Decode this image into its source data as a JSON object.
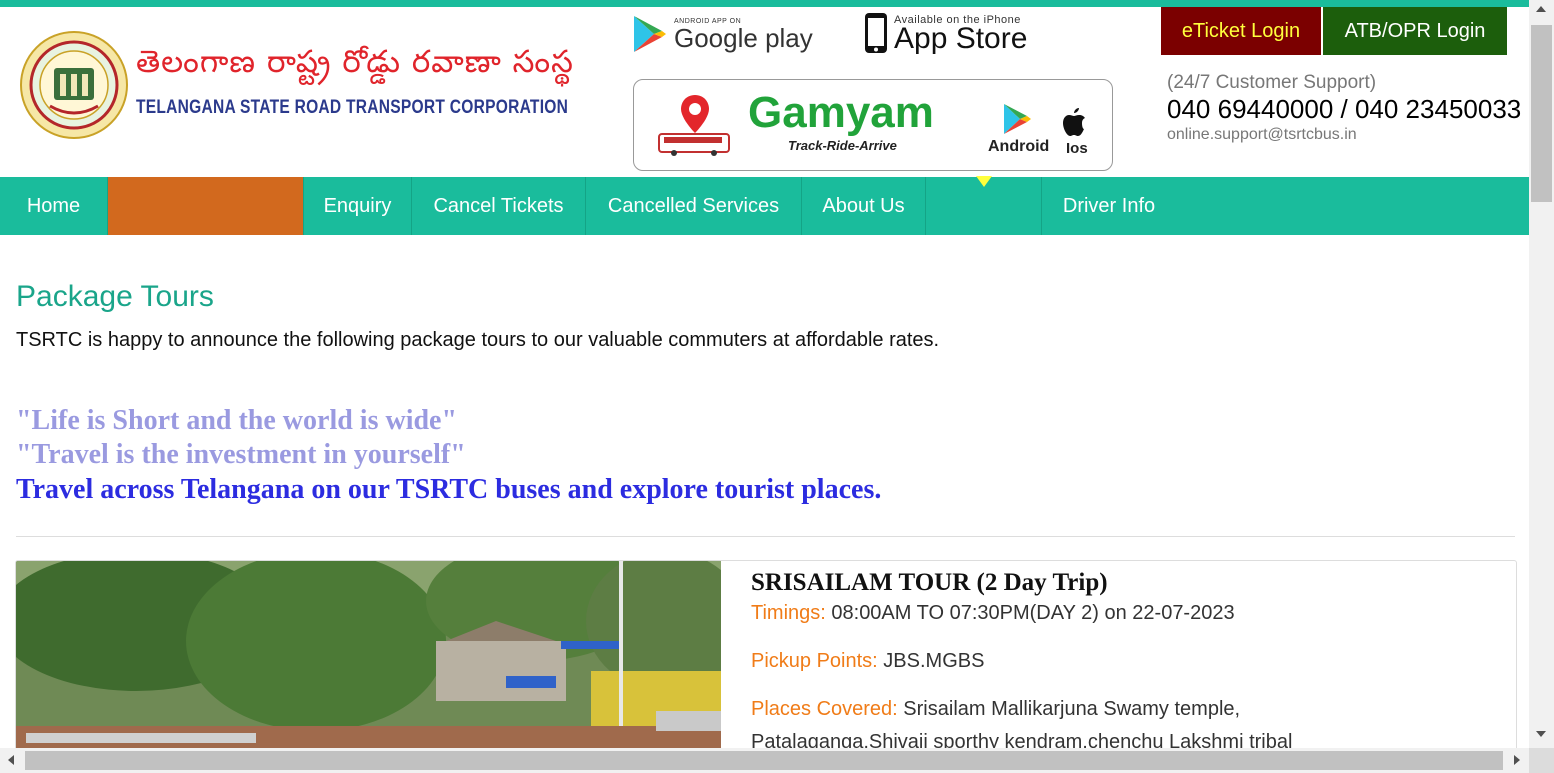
{
  "header": {
    "brand_telugu": "తెలంగాణ  రాష్ట్ర రోడ్డు రవాణా సంస్థ",
    "brand_english": "TELANGANA STATE ROAD TRANSPORT CORPORATION",
    "google_small": "ANDROID APP ON",
    "google_big": "Google play",
    "apple_small": "Available on the iPhone",
    "apple_big": "App Store",
    "gamyam": {
      "title": "Gamyam",
      "tagline": "Track-Ride-Arrive",
      "android": "Android",
      "ios": "Ios"
    },
    "eticket_label": "eTicket Login",
    "atb_label": "ATB/OPR Login",
    "support_label": "(24/7 Customer Support)",
    "support_phone": "040 69440000 / 040 23450033",
    "support_email": "online.support@tsrtcbus.in"
  },
  "nav": {
    "items": [
      {
        "label": "Home"
      },
      {
        "label": ""
      },
      {
        "label": "Enquiry"
      },
      {
        "label": "Cancel Tickets"
      },
      {
        "label": "Cancelled Services"
      },
      {
        "label": "About Us"
      },
      {
        "label": ""
      },
      {
        "label": "Driver Info"
      }
    ]
  },
  "main": {
    "title": "Package Tours",
    "intro": "TSRTC is happy to announce the following package tours to our valuable commuters at affordable rates.",
    "quote1": "\"Life is Short and the world is wide\"",
    "quote2": "\"Travel is the investment in yourself\"",
    "quote3": "Travel across Telangana on our TSRTC buses and explore tourist places.",
    "tour": {
      "title": "SRISAILAM TOUR (2 Day Trip)",
      "timings_key": "Timings:",
      "timings_val": " 08:00AM TO 07:30PM(DAY 2) on 22-07-2023",
      "pickup_key": "Pickup Points:",
      "pickup_val": " JBS.MGBS",
      "places_key": "Places Covered:",
      "places_val": " Srisailam Mallikarjuna Swamy temple,",
      "places_val2": "Patalaganga,Shivaji sporthy kendram,chenchu Lakshmi tribal"
    }
  },
  "colors": {
    "accent": "#1abc9c",
    "nav_highlight": "#d2691e",
    "eticket_bg": "#7b0000",
    "atb_bg": "#1c5e0c",
    "quote_light": "#9a9ae0",
    "quote_dark": "#2c2ce0",
    "label_orange": "#f07c18"
  }
}
